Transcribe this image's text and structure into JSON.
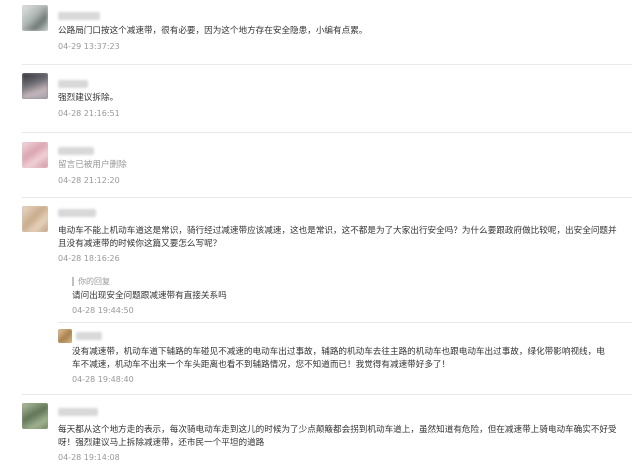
{
  "comments": [
    {
      "text": "公路局门口按这个减速带，很有必要，因为这个地方存在安全隐患，小编有点累。",
      "time": "04-29 13:37:23"
    },
    {
      "text": "强烈建议拆除。",
      "time": "04-28 21:16:51"
    },
    {
      "text": "留言已被用户删除",
      "time": "04-28 21:12:20"
    },
    {
      "text_line1": "电动车不能上机动车道这是常识，骑行经过减速带应该减速，这也是常识，这不都是为了大家出行安全吗？为什么要跟政府做比较呢，出安全问题并",
      "text_line2": "且没有减速带的时候你这篇又要怎么写呢？",
      "time": "04-28 18:16:26",
      "reply_label": "你的回复",
      "reply_text": "请问出现安全问题跟减速带有直接关系吗",
      "reply_time": "04-28 19:44:50",
      "sub_text_line1": "没有减速带，机动车道下辅路的车碰见不减速的电动车出过事故，辅路的机动车去往主路的机动车也跟电动车出过事故，绿化带影响视线，电",
      "sub_text_line2": "车不减速，机动车不出来一个车头距离也看不到辅路情况，您不知道而已！我觉得有减速带好多了！",
      "sub_time": "04-28 19:48:40"
    },
    {
      "text_line1": "每天都从这个地方走的表示，每次骑电动车走到这儿的时候为了少点颠簸都会拐到机动车道上，虽然知道有危险，但在减速带上骑电动车确实不好受",
      "text_line2": "呀！强烈建议马上拆除减速带，还市民一个平坦的道路",
      "time": "04-28 19:14:08"
    }
  ]
}
